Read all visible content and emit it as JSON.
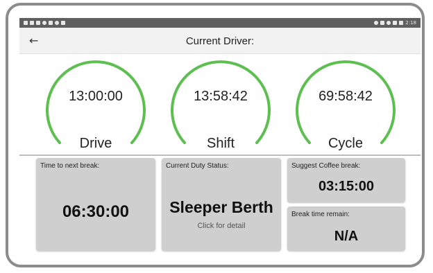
{
  "statusbar": {
    "left_icons": [
      "warning-icon",
      "image-icon",
      "lock-icon",
      "circle-icon",
      "n-icon",
      "wifi-icon",
      "play-icon"
    ],
    "right_icons": [
      "location-icon",
      "vibrate-icon",
      "alarm-icon",
      "signal-icon",
      "battery-icon"
    ],
    "time": "2:18"
  },
  "header": {
    "back_icon": "arrow-left-icon",
    "title": "Current Driver:"
  },
  "gauges": [
    {
      "time": "13:00:00",
      "label": "Drive",
      "color": "#5cbf4f"
    },
    {
      "time": "13:58:42",
      "label": "Shift",
      "color": "#5cbf4f"
    },
    {
      "time": "69:58:42",
      "label": "Cycle",
      "color": "#5cbf4f"
    }
  ],
  "cards": {
    "next_break": {
      "caption": "Time to next break:",
      "value": "06:30:00"
    },
    "duty_status": {
      "caption": "Current Duty Status:",
      "value": "Sleeper Berth",
      "hint": "Click for detail"
    },
    "coffee_break": {
      "caption": "Suggest Coffee break:",
      "value": "03:15:00"
    },
    "break_remain": {
      "caption": "Break time remain:",
      "value": "N/A"
    }
  },
  "colors": {
    "gauge_green": "#5cbf4f",
    "card_bg": "#cfcfcf",
    "statusbar_bg": "#5f5f5f"
  }
}
